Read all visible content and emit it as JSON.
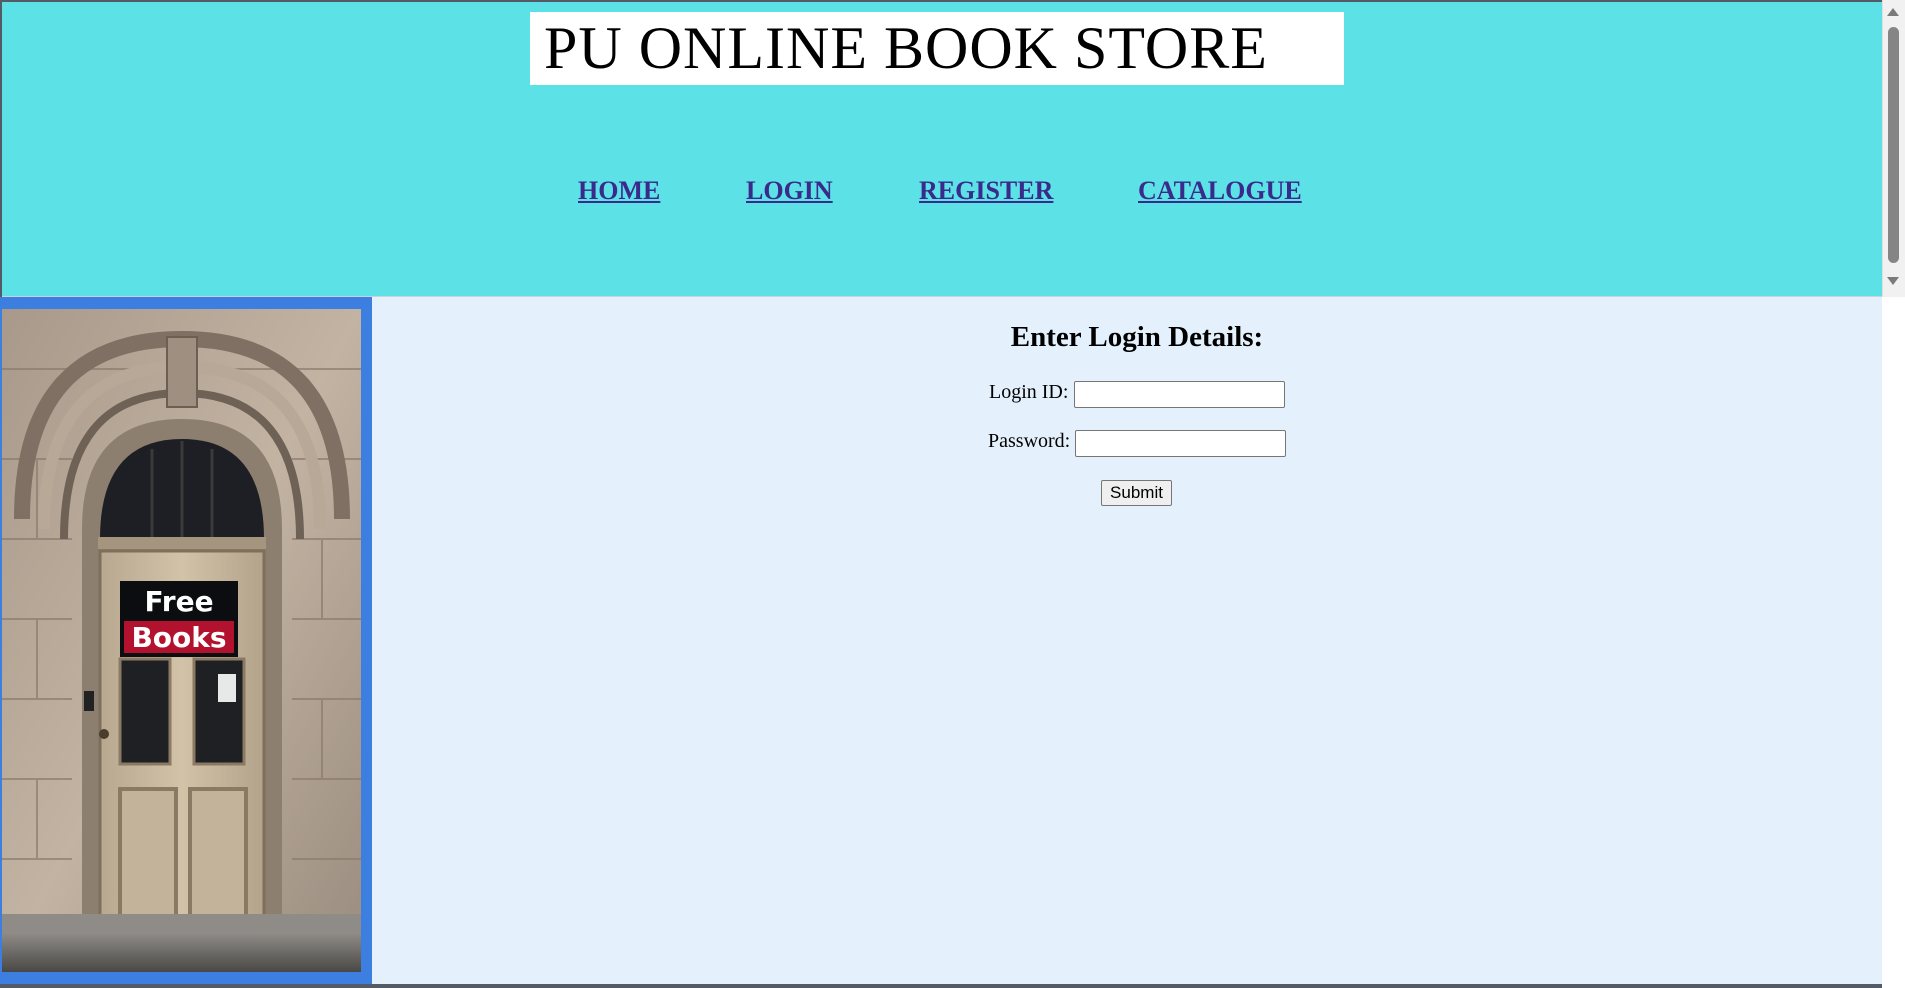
{
  "header": {
    "title": "PU ONLINE BOOK STORE",
    "nav": [
      {
        "label": "HOME"
      },
      {
        "label": "LOGIN"
      },
      {
        "label": "REGISTER"
      },
      {
        "label": "CATALOGUE"
      }
    ]
  },
  "sidebar": {
    "sign_line1": "Free",
    "sign_line2": "Books"
  },
  "login": {
    "heading": "Enter Login Details:",
    "login_id_label": "Login ID:",
    "login_id_value": "",
    "password_label": "Password:",
    "password_value": "",
    "submit_label": "Submit"
  },
  "colors": {
    "header_bg": "#5ce2e6",
    "main_bg": "#e4f1fd",
    "sidebar_border": "#3c7fe0",
    "link": "#3a2a8c"
  }
}
